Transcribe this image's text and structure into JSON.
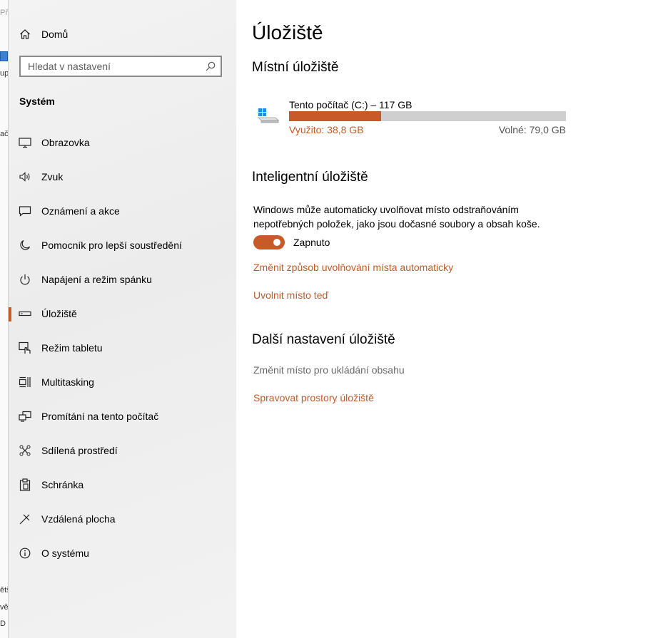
{
  "background_window": {
    "fragments": [
      "Př",
      "up",
      "ač",
      "ětš",
      "vě",
      "D"
    ]
  },
  "sidebar": {
    "home_label": "Domů",
    "search_placeholder": "Hledat v nastavení",
    "section_title": "Systém",
    "items": [
      {
        "label": "Obrazovka",
        "icon": "monitor-icon"
      },
      {
        "label": "Zvuk",
        "icon": "speaker-icon"
      },
      {
        "label": "Oznámení a akce",
        "icon": "notification-icon"
      },
      {
        "label": "Pomocník pro lepší soustředění",
        "icon": "moon-icon"
      },
      {
        "label": "Napájení a režim spánku",
        "icon": "power-icon"
      },
      {
        "label": "Úložiště",
        "icon": "storage-icon",
        "selected": true
      },
      {
        "label": "Režim tabletu",
        "icon": "tablet-mode-icon"
      },
      {
        "label": "Multitasking",
        "icon": "multitasking-icon"
      },
      {
        "label": "Promítání na tento počítač",
        "icon": "projecting-icon"
      },
      {
        "label": "Sdílená prostředí",
        "icon": "shared-experiences-icon"
      },
      {
        "label": "Schránka",
        "icon": "clipboard-icon"
      },
      {
        "label": "Vzdálená plocha",
        "icon": "remote-desktop-icon"
      },
      {
        "label": "O systému",
        "icon": "info-icon"
      }
    ]
  },
  "main": {
    "title": "Úložiště",
    "local_storage": {
      "heading": "Místní úložiště",
      "drive": {
        "name": "Tento počítač (C:) – 117 GB",
        "used_label": "Využito: 38,8 GB",
        "free_label": "Volné: 79,0 GB",
        "used_fraction": 0.332
      }
    },
    "storage_sense": {
      "heading": "Inteligentní úložiště",
      "description": "Windows může automaticky uvolňovat místo odstraňováním nepotřebných položek, jako jsou dočasné soubory a obsah koše.",
      "toggle_on": true,
      "toggle_label": "Zapnuto",
      "link_change": "Změnit způsob uvolňování místa automaticky",
      "link_free_now": "Uvolnit místo teď"
    },
    "more_settings": {
      "heading": "Další nastavení úložiště",
      "change_save_location": "Změnit místo pro ukládání obsahu",
      "manage_spaces": "Spravovat prostory úložiště"
    }
  },
  "colors": {
    "accent": "#c75a28",
    "bar_track": "#cfcfcf",
    "sidebar_bg": "#f2f2f2"
  }
}
